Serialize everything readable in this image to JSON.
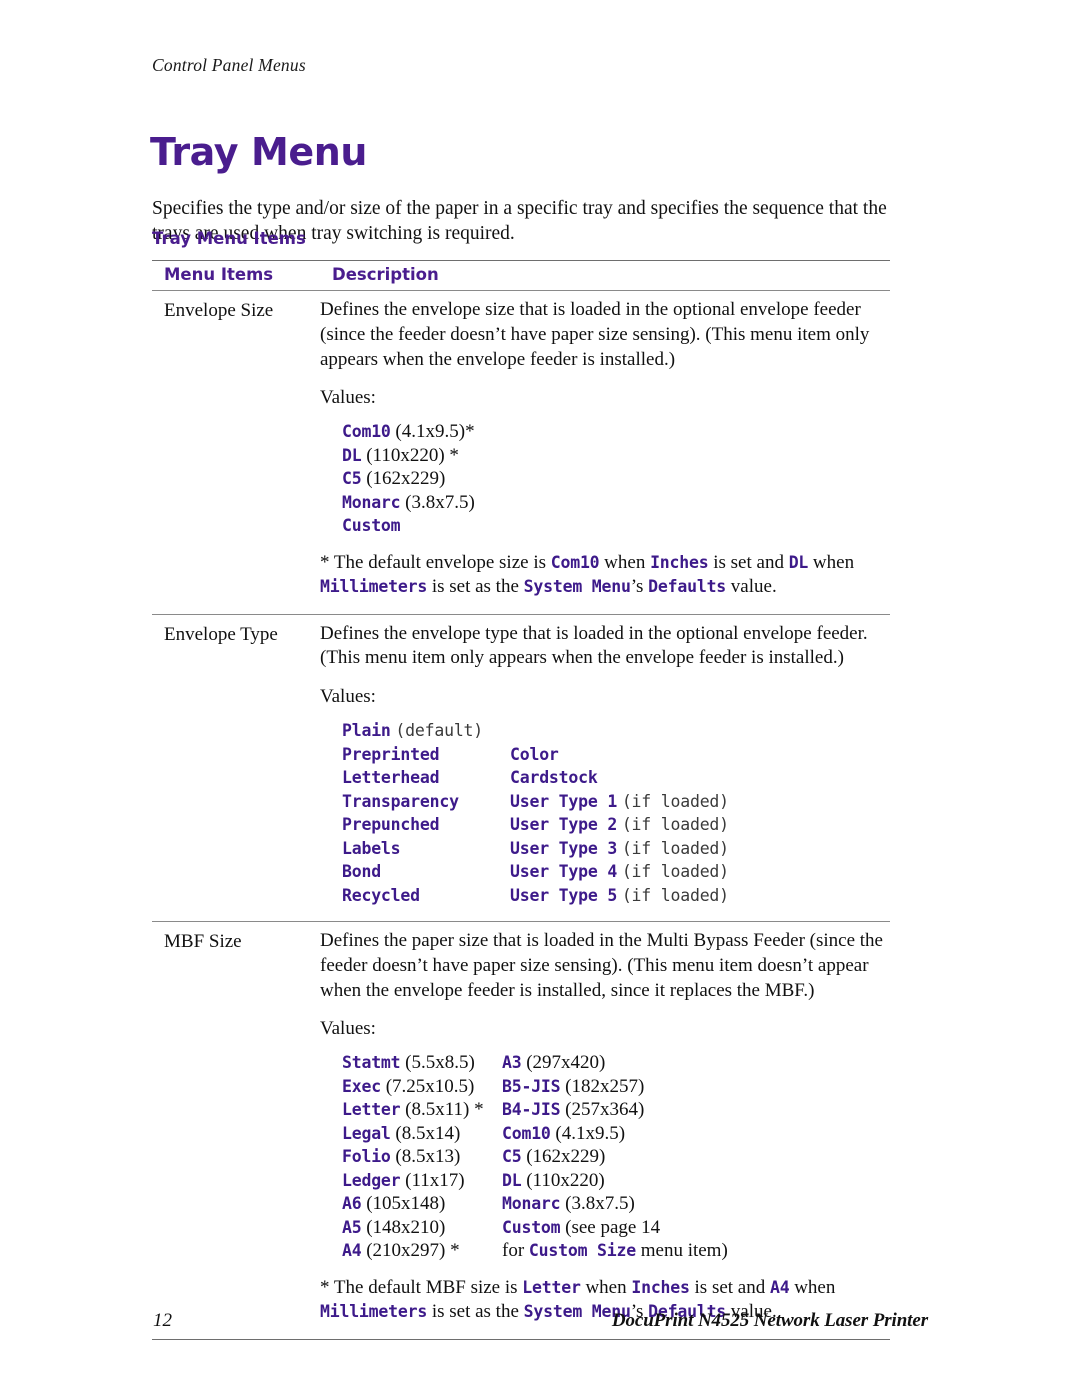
{
  "page": {
    "running_head": "Control Panel Menus",
    "title": "Tray Menu",
    "intro": "Specifies the type and/or size of the paper in a specific tray and specifies the sequence that the trays are used when tray switching is required.",
    "accent_color": "#4a1d8e",
    "mono_color": "#3d1a8a",
    "rule_color": "#6e6e6e"
  },
  "table": {
    "caption": "Tray Menu Items",
    "headers": {
      "menu_items": "Menu Items",
      "description": "Description"
    },
    "rows": [
      {
        "item": "Envelope Size",
        "desc_1": "Defines the envelope size that is loaded in the optional envelope feeder",
        "desc_2": "(since the feeder doesn’t have paper size sensing). (This menu item only",
        "desc_3": "appears when the envelope feeder is installed.)",
        "values_label": "Values:",
        "values": [
          {
            "code": "Com10",
            "note": "(4.1x9.5)*"
          },
          {
            "code": "DL",
            "note": "(110x220) *"
          },
          {
            "code": "C5",
            "note": "(162x229)"
          },
          {
            "code": "Monarc",
            "note": "(3.8x7.5)"
          },
          {
            "code": "Custom",
            "note": ""
          }
        ],
        "footnote": {
          "p1": "* The default envelope size is ",
          "c1": "Com10",
          "p2": " when ",
          "c2": "Inches",
          "p3": " is set and ",
          "c3": "DL",
          "p4": " when",
          "c4": "Millimeters",
          "p5": " is set as the ",
          "c5": "System Menu",
          "p6": "’s ",
          "c6": "Defaults",
          "p7": " value."
        }
      },
      {
        "item": "Envelope Type",
        "desc_1": "Defines the envelope type that is loaded in the optional envelope feeder.",
        "desc_2": "(This menu item only appears when the envelope feeder is installed.)",
        "desc_3": "",
        "values_label": "Values:",
        "values_two_col": [
          {
            "left_code": "Plain",
            "left_note": "(default)",
            "right_code": "",
            "right_note": ""
          },
          {
            "left_code": "Preprinted",
            "left_note": "",
            "right_code": "Color",
            "right_note": ""
          },
          {
            "left_code": "Letterhead",
            "left_note": "",
            "right_code": "Cardstock",
            "right_note": ""
          },
          {
            "left_code": "Transparency",
            "left_note": "",
            "right_code": "User Type 1",
            "right_note": "(if loaded)"
          },
          {
            "left_code": "Prepunched",
            "left_note": "",
            "right_code": "User Type 2",
            "right_note": "(if loaded)"
          },
          {
            "left_code": "Labels",
            "left_note": "",
            "right_code": "User Type 3",
            "right_note": "(if loaded)"
          },
          {
            "left_code": "Bond",
            "left_note": "",
            "right_code": "User Type 4",
            "right_note": "(if loaded)"
          },
          {
            "left_code": "Recycled",
            "left_note": "",
            "right_code": "User Type 5",
            "right_note": "(if loaded)"
          }
        ]
      },
      {
        "item": "MBF Size",
        "desc_1": "Defines the paper size that is loaded in the Multi Bypass Feeder (since the",
        "desc_2": "feeder doesn’t have paper size sensing). (This menu item doesn’t appear",
        "desc_3": "when the envelope feeder is installed, since it replaces the MBF.)",
        "values_label": "Values:",
        "values_two_col": [
          {
            "left_code": "Statmt",
            "left_note": "(5.5x8.5)",
            "right_code": "A3",
            "right_note": "(297x420)"
          },
          {
            "left_code": "Exec",
            "left_note": "(7.25x10.5)",
            "right_code": "B5-JIS",
            "right_note": "(182x257)"
          },
          {
            "left_code": "Letter",
            "left_note": "(8.5x11) *",
            "right_code": "B4-JIS",
            "right_note": "(257x364)"
          },
          {
            "left_code": "Legal",
            "left_note": "(8.5x14)",
            "right_code": "Com10",
            "right_note": "(4.1x9.5)"
          },
          {
            "left_code": "Folio",
            "left_note": "(8.5x13)",
            "right_code": "C5",
            "right_note": "(162x229)"
          },
          {
            "left_code": "Ledger",
            "left_note": "(11x17)",
            "right_code": "DL",
            "right_note": "(110x220)"
          },
          {
            "left_code": "A6",
            "left_note": "(105x148)",
            "right_code": "Monarc",
            "right_note": "(3.8x7.5)"
          },
          {
            "left_code": "A5",
            "left_note": "(148x210)",
            "right_code": "Custom",
            "right_note": "(see page 14"
          },
          {
            "left_code": "A4",
            "left_note": "(210x297) *",
            "right_code": "",
            "right_note": ""
          }
        ],
        "continuation": {
          "p1": "for ",
          "c1": "Custom Size",
          "p2": " menu item)"
        },
        "footnote": {
          "p1": "* The default MBF size is ",
          "c1": "Letter",
          "p2": " when ",
          "c2": "Inches",
          "p3": " is set and ",
          "c3": "A4",
          "p4": " when",
          "c4": "Millimeters",
          "p5": " is set as the ",
          "c5": "System Menu",
          "p6": "’s ",
          "c6": "Defaults",
          "p7": " value."
        }
      }
    ]
  },
  "footer": {
    "page_number": "12",
    "product": "DocuPrint N4525 Network Laser Printer"
  }
}
